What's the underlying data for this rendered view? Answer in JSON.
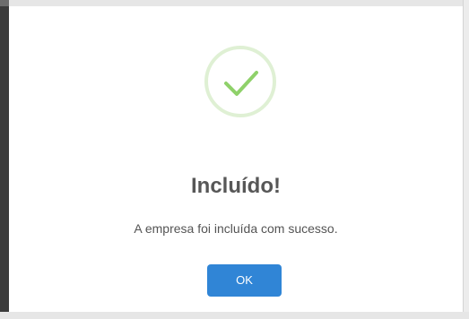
{
  "dialog": {
    "icon": "success-check-icon",
    "title": "Incluído!",
    "message": "A empresa foi incluída com sucesso.",
    "confirm_label": "OK"
  },
  "colors": {
    "success_ring": "#dff0d4",
    "success_check": "#8fd16a",
    "confirm_button": "#3085d6",
    "title_text": "#575757"
  }
}
